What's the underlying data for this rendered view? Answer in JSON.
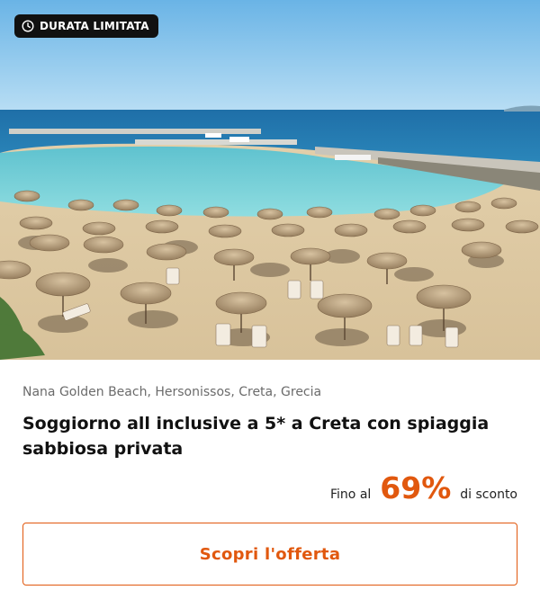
{
  "badge": {
    "icon": "clock-icon",
    "label": "DURATA LIMITATA"
  },
  "offer": {
    "location": "Nana Golden Beach, Hersonissos, Creta, Grecia",
    "title": "Soggiorno all inclusive a 5* a Creta con spiaggia sabbiosa privata",
    "discount_prefix": "Fino al",
    "discount_value": "69%",
    "discount_suffix": "di sconto",
    "cta_label": "Scopri l'offerta"
  },
  "colors": {
    "accent": "#e1580e",
    "badge_bg": "#111111"
  }
}
